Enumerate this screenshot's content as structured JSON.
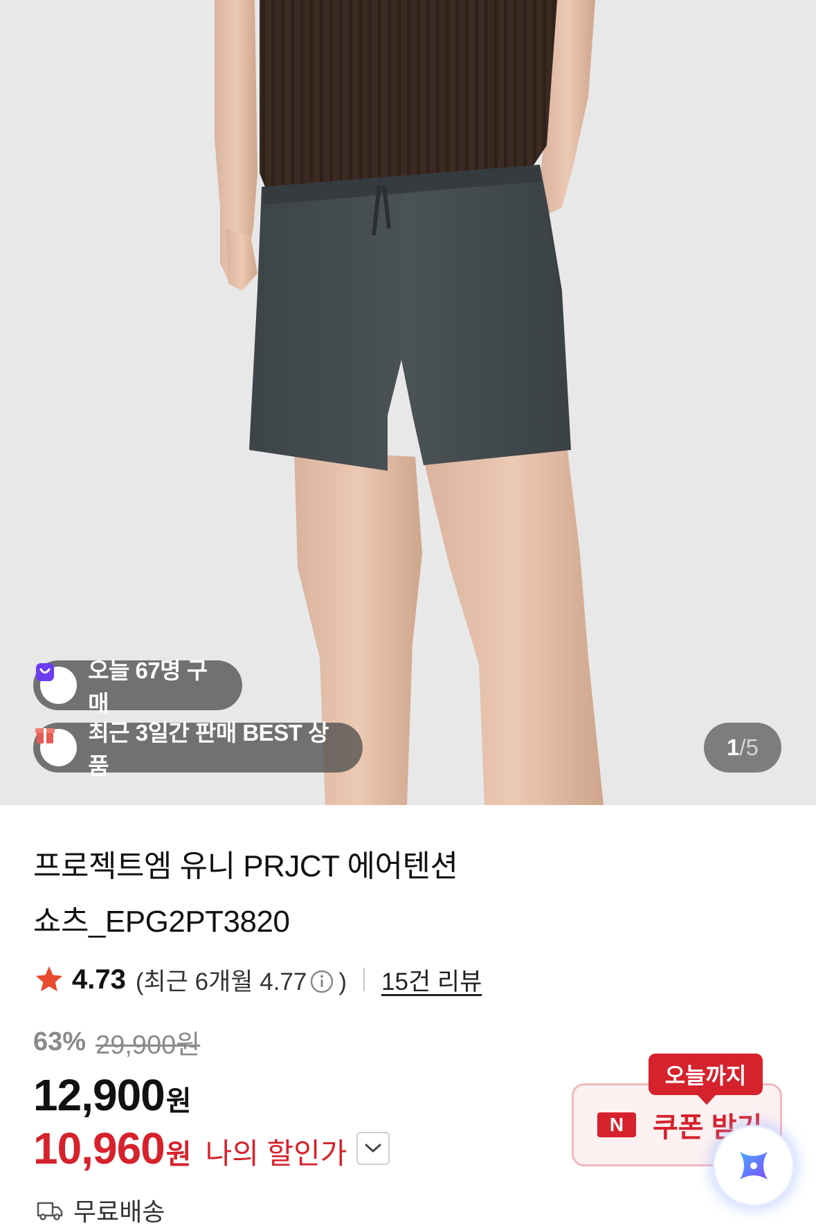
{
  "gallery": {
    "badges": [
      {
        "icon": "shopping-bag-icon",
        "text": "오늘 67명 구매"
      },
      {
        "icon": "gift-box-icon",
        "text": "최근 3일간 판매 BEST 상품"
      }
    ],
    "counter": {
      "current": "1",
      "separator": "/",
      "total": "5"
    }
  },
  "product": {
    "title_line1": "프로젝트엠 유니 PRJCT 에어텐션",
    "title_line2": "쇼츠_EPG2PT3820",
    "rating": {
      "score": "4.73",
      "recent_prefix": "(최근 6개월 4.77",
      "recent_suffix": ")",
      "reviews_link": "15건 리뷰"
    },
    "pricing": {
      "discount_pct": "63%",
      "original_price": "29,900원",
      "price": "12,900",
      "price_unit": "원",
      "my_price": "10,960",
      "my_price_unit": "원",
      "my_price_label": "나의 할인가"
    },
    "shipping": "무료배송"
  },
  "coupon": {
    "tag": "오늘까지",
    "logo": "N",
    "label": "쿠폰 받기"
  },
  "colors": {
    "accent_red": "#d6222c",
    "badge_purple": "#6b3cf0",
    "star": "#e84a2f"
  }
}
